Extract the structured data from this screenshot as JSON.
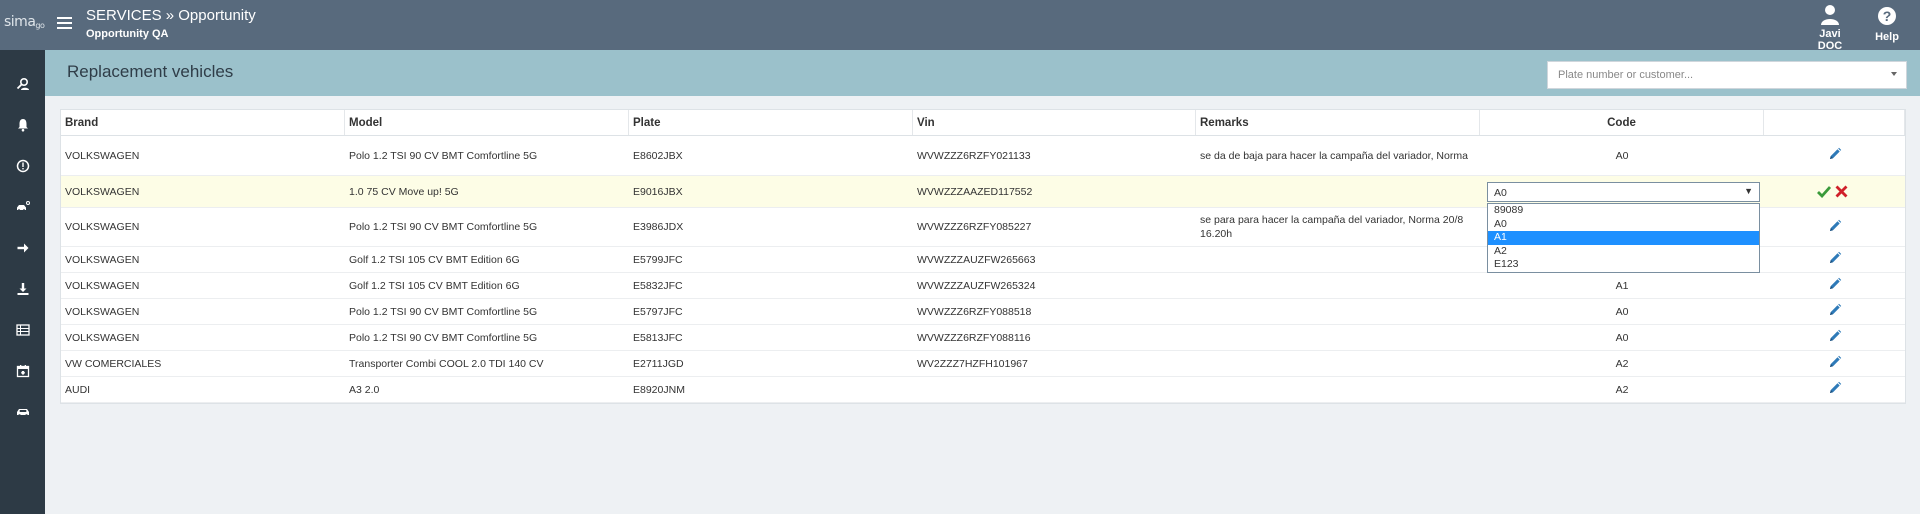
{
  "app": {
    "logo_text": "sima",
    "logo_sub": "go"
  },
  "header": {
    "title": "SERVICES » Opportunity",
    "subtitle": "Opportunity QA"
  },
  "user": {
    "name": "Javi DOC",
    "help_label": "Help"
  },
  "page": {
    "title": "Replacement vehicles",
    "search_placeholder": "Plate number or customer..."
  },
  "sidebar": {
    "icons": [
      "user-search-icon",
      "bell-icon",
      "alert-icon",
      "car-key-icon",
      "arrow-right-icon",
      "download-icon",
      "list-icon",
      "calendar-icon",
      "car-icon"
    ]
  },
  "table": {
    "headers": {
      "brand": "Brand",
      "model": "Model",
      "plate": "Plate",
      "vin": "Vin",
      "remarks": "Remarks",
      "code": "Code"
    },
    "rows": [
      {
        "brand": "VOLKSWAGEN",
        "model": "Polo 1.2 TSI 90 CV BMT Comfortline 5G",
        "plate": "E8602JBX",
        "vin": "WVWZZZ6RZFY021133",
        "remarks": "se da de baja para hacer la campaña del variador, Norma",
        "code": "A0"
      },
      {
        "brand": "VOLKSWAGEN",
        "model": "1.0 75 CV Move up! 5G",
        "plate": "E9016JBX",
        "vin": "WVWZZZAAZED117552",
        "remarks": "",
        "code": ""
      },
      {
        "brand": "VOLKSWAGEN",
        "model": "Polo 1.2 TSI 90 CV BMT Comfortline 5G",
        "plate": "E3986JDX",
        "vin": "WVWZZZ6RZFY085227",
        "remarks": "se para para hacer la campaña del variador, Norma 20/8 16.20h",
        "code": ""
      },
      {
        "brand": "VOLKSWAGEN",
        "model": "Golf 1.2 TSI 105 CV BMT Edition 6G",
        "plate": "E5799JFC",
        "vin": "WVWZZZAUZFW265663",
        "remarks": "",
        "code": ""
      },
      {
        "brand": "VOLKSWAGEN",
        "model": "Golf 1.2 TSI 105 CV BMT Edition 6G",
        "plate": "E5832JFC",
        "vin": "WVWZZZAUZFW265324",
        "remarks": "",
        "code": "A1"
      },
      {
        "brand": "VOLKSWAGEN",
        "model": "Polo 1.2 TSI 90 CV BMT Comfortline 5G",
        "plate": "E5797JFC",
        "vin": "WVWZZZ6RZFY088518",
        "remarks": "",
        "code": "A0"
      },
      {
        "brand": "VOLKSWAGEN",
        "model": "Polo 1.2 TSI 90 CV BMT Comfortline 5G",
        "plate": "E5813JFC",
        "vin": "WVWZZZ6RZFY088116",
        "remarks": "",
        "code": "A0"
      },
      {
        "brand": "VW COMERCIALES",
        "model": "Transporter Combi COOL 2.0 TDI 140 CV",
        "plate": "E2711JGD",
        "vin": "WV2ZZZ7HZFH101967",
        "remarks": "",
        "code": "A2"
      },
      {
        "brand": "AUDI",
        "model": "A3 2.0",
        "plate": "E8920JNM",
        "vin": "",
        "remarks": "",
        "code": "A2"
      }
    ]
  },
  "code_select": {
    "value": "A0",
    "options": [
      "89089",
      "A0",
      "A1",
      "A2",
      "E123"
    ],
    "highlighted": "A1"
  },
  "colors": {
    "topbar": "#586a7d",
    "sidebar": "#2d3a45",
    "band": "#9bc1cb",
    "accent": "#2e7ab8",
    "ok": "#3a9a3a",
    "cancel": "#d0202a"
  }
}
